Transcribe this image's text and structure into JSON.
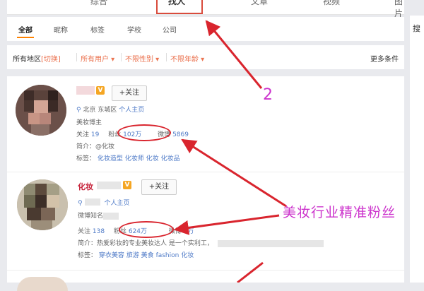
{
  "top_tabs": {
    "items": [
      "综合",
      "找人",
      "文章",
      "视频",
      "图片"
    ],
    "active_index": 1
  },
  "sub_tabs": {
    "items": [
      "全部",
      "昵称",
      "标签",
      "学校",
      "公司"
    ],
    "active_index": 0
  },
  "filters": {
    "region": "所有地区",
    "switch": "[切换]",
    "user_type": "所有用户",
    "gender": "不限性别",
    "age": "不限年龄",
    "more": "更多条件"
  },
  "right_sidebar": {
    "label": "搜"
  },
  "results": [
    {
      "vip_badge": "V",
      "follow_label": "+关注",
      "location": "北京 东城区",
      "home_link": "个人主页",
      "desc": "美妆博主",
      "following_label": "关注",
      "following_count": "19",
      "fans_label": "粉丝",
      "fans_count": "102万",
      "weibo_label": "微博",
      "weibo_count": "5869",
      "bio_label": "简介：",
      "bio_text": "@化妆",
      "tags_label": "标签：",
      "tags": [
        "化妆造型",
        "化妆师",
        "化妆",
        "化妆品"
      ]
    },
    {
      "name": "化妆",
      "vip_badge": "V",
      "follow_label": "+关注",
      "home_link": "个人主页",
      "desc": "微博知名",
      "following_label": "关注",
      "following_count": "138",
      "fans_label": "粉丝",
      "fans_count": "624万",
      "weibo_label": "微博",
      "weibo_count": "6万",
      "bio_label": "简介：",
      "bio_text": "热爱彩妆的专业美妆达人 是一个实利工，",
      "tags_label": "标签：",
      "tags": [
        "穿衣美容",
        "旅游",
        "美食",
        "fashion",
        "化妆"
      ]
    }
  ],
  "annotations": {
    "number_two": "2",
    "caption": "美妆行业精准粉丝"
  },
  "colors": {
    "accent_orange": "#ff8200",
    "name_red": "#c6223a",
    "link_blue": "#4e7ac7",
    "annotation_red": "#d9252e",
    "annotation_magenta": "#cc33cc"
  }
}
